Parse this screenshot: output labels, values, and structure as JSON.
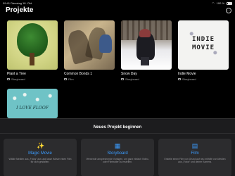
{
  "status_bar": {
    "time": "09:41",
    "date": "Dienstag 18. Okt.",
    "battery": "100 %"
  },
  "header": {
    "title": "Projekte",
    "more_glyph": "…"
  },
  "projects": [
    {
      "title": "Plant a Tree",
      "type": "Storyboard"
    },
    {
      "title": "Common Bonds 1",
      "type": "Film"
    },
    {
      "title": "Snow Day",
      "type": "Storyboard"
    },
    {
      "title": "Indie Movie",
      "type": "Storyboard",
      "thumb_text_1": "INDIE",
      "thumb_text_2": "MOVIE"
    },
    {
      "thumb_text": "I LOVE FLOOF"
    }
  ],
  "new_project": {
    "title": "Neues Projekt beginnen",
    "options": [
      {
        "icon": "magic-wand-icon",
        "glyph": "✨",
        "label": "Magic Movie",
        "description": "Wähle Medien aus „Fotos“ aus und lasse iMovie einen Film für dich gestalten."
      },
      {
        "icon": "storyboard-icon",
        "glyph": "▦",
        "label": "Storyboard",
        "description": "Verwende ansprechende Vorlagen, um ganz einfach Video- oder Filmtrailer zu erstellen."
      },
      {
        "icon": "film-icon",
        "glyph": "▤",
        "label": "Film",
        "description": "Erstelle einen Film von Grund auf neu mithilfe von Medien aus „Fotos“ und deiner Kamera."
      }
    ]
  },
  "colors": {
    "accent": "#3b9cff",
    "background": "#000000",
    "sheet": "#1c1c1e",
    "option_bg": "#2c2c2e"
  }
}
